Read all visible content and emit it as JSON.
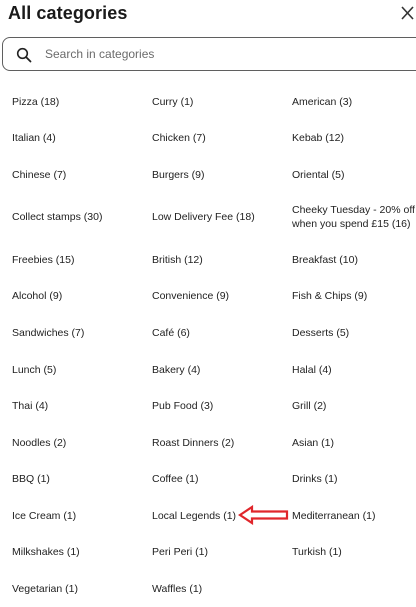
{
  "header": {
    "title": "All categories"
  },
  "search": {
    "placeholder": "Search in categories",
    "value": ""
  },
  "categories": [
    [
      "Pizza (18)",
      "Curry (1)",
      "American (3)"
    ],
    [
      "Italian (4)",
      "Chicken (7)",
      "Kebab (12)"
    ],
    [
      "Chinese (7)",
      "Burgers (9)",
      "Oriental (5)"
    ],
    [
      "Collect stamps (30)",
      "Low Delivery Fee (18)",
      "Cheeky Tuesday - 20% off when you spend £15 (16)"
    ],
    [
      "Freebies (15)",
      "British (12)",
      "Breakfast (10)"
    ],
    [
      "Alcohol (9)",
      "Convenience (9)",
      "Fish & Chips (9)"
    ],
    [
      "Sandwiches (7)",
      "Café (6)",
      "Desserts (5)"
    ],
    [
      "Lunch (5)",
      "Bakery (4)",
      "Halal (4)"
    ],
    [
      "Thai (4)",
      "Pub Food (3)",
      "Grill (2)"
    ],
    [
      "Noodles (2)",
      "Roast Dinners (2)",
      "Asian (1)"
    ],
    [
      "BBQ (1)",
      "Coffee (1)",
      "Drinks (1)"
    ],
    [
      "Ice Cream (1)",
      "Local Legends (1)",
      "Mediterranean (1)"
    ],
    [
      "Milkshakes (1)",
      "Peri Peri (1)",
      "Turkish (1)"
    ],
    [
      "Vegetarian (1)",
      "Waffles (1)",
      ""
    ]
  ],
  "colors": {
    "annotation_arrow": "#e0262b",
    "text": "#222222",
    "border": "#5f5f5f"
  },
  "icons": {
    "search": "search-icon",
    "close": "close-icon",
    "annotation": "arrow-left-icon"
  }
}
